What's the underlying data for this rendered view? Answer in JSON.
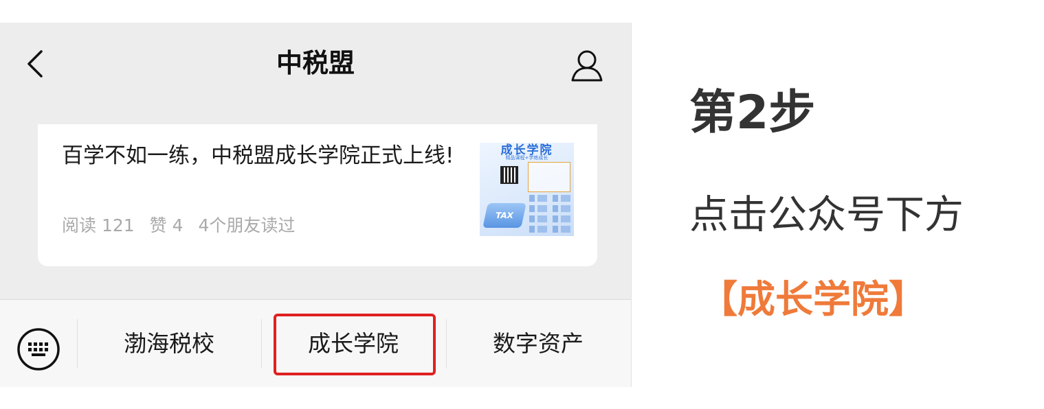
{
  "header": {
    "title": "中税盟",
    "back_icon": "chevron-left-icon",
    "profile_icon": "person-icon"
  },
  "article": {
    "title": "百学不如一练，中税盟成长学院正式上线!",
    "reads": "阅读 121",
    "likes": "赞 4",
    "friends": "4个朋友读过",
    "thumbnail": {
      "title": "成长学院",
      "subtitle": "精品课程+学练成长",
      "badge": "TAX"
    }
  },
  "menubar": {
    "keyboard_icon": "keyboard-icon",
    "items": [
      {
        "label": "渤海税校"
      },
      {
        "label": "成长学院"
      },
      {
        "label": "数字资产"
      }
    ],
    "highlight_color": "#e02020"
  },
  "instructions": {
    "step": "第2步",
    "description": "点击公众号下方",
    "target": "【成长学院】",
    "target_color": "#ef7a3a"
  }
}
